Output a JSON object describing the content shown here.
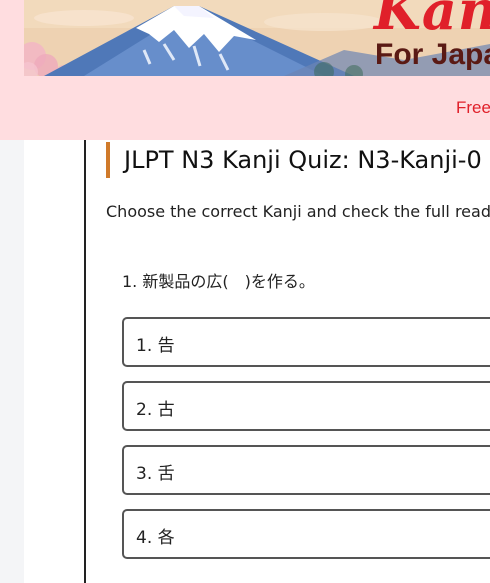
{
  "header": {
    "banner_title": "Kan",
    "banner_subtitle": "For Japa",
    "free_link": "Free"
  },
  "quiz": {
    "title": "JLPT N3 Kanji Quiz: N3-Kanji-0",
    "instruction": "Choose the correct Kanji and check the full readi",
    "question": "1. 新製品の広(　)を作る。",
    "options": [
      {
        "label": "1. 告"
      },
      {
        "label": "2. 古"
      },
      {
        "label": "3. 舌"
      },
      {
        "label": "4. 各"
      }
    ]
  },
  "colors": {
    "header_bg": "#ffdde0",
    "title_accent": "#d07a2a",
    "link_red": "#e0202a",
    "subtitle_brown": "#5a1a14"
  }
}
